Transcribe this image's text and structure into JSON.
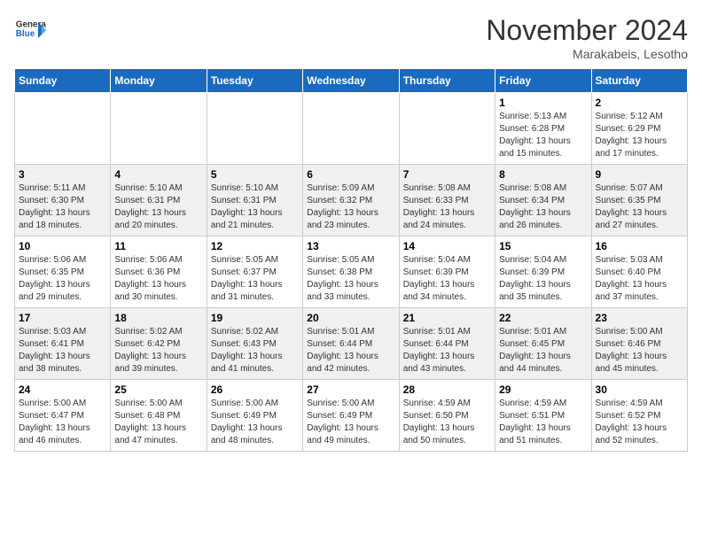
{
  "header": {
    "logo_general": "General",
    "logo_blue": "Blue",
    "month": "November 2024",
    "location": "Marakabeis, Lesotho"
  },
  "weekdays": [
    "Sunday",
    "Monday",
    "Tuesday",
    "Wednesday",
    "Thursday",
    "Friday",
    "Saturday"
  ],
  "weeks": [
    [
      {
        "day": "",
        "info": ""
      },
      {
        "day": "",
        "info": ""
      },
      {
        "day": "",
        "info": ""
      },
      {
        "day": "",
        "info": ""
      },
      {
        "day": "",
        "info": ""
      },
      {
        "day": "1",
        "info": "Sunrise: 5:13 AM\nSunset: 6:28 PM\nDaylight: 13 hours and 15 minutes."
      },
      {
        "day": "2",
        "info": "Sunrise: 5:12 AM\nSunset: 6:29 PM\nDaylight: 13 hours and 17 minutes."
      }
    ],
    [
      {
        "day": "3",
        "info": "Sunrise: 5:11 AM\nSunset: 6:30 PM\nDaylight: 13 hours and 18 minutes."
      },
      {
        "day": "4",
        "info": "Sunrise: 5:10 AM\nSunset: 6:31 PM\nDaylight: 13 hours and 20 minutes."
      },
      {
        "day": "5",
        "info": "Sunrise: 5:10 AM\nSunset: 6:31 PM\nDaylight: 13 hours and 21 minutes."
      },
      {
        "day": "6",
        "info": "Sunrise: 5:09 AM\nSunset: 6:32 PM\nDaylight: 13 hours and 23 minutes."
      },
      {
        "day": "7",
        "info": "Sunrise: 5:08 AM\nSunset: 6:33 PM\nDaylight: 13 hours and 24 minutes."
      },
      {
        "day": "8",
        "info": "Sunrise: 5:08 AM\nSunset: 6:34 PM\nDaylight: 13 hours and 26 minutes."
      },
      {
        "day": "9",
        "info": "Sunrise: 5:07 AM\nSunset: 6:35 PM\nDaylight: 13 hours and 27 minutes."
      }
    ],
    [
      {
        "day": "10",
        "info": "Sunrise: 5:06 AM\nSunset: 6:35 PM\nDaylight: 13 hours and 29 minutes."
      },
      {
        "day": "11",
        "info": "Sunrise: 5:06 AM\nSunset: 6:36 PM\nDaylight: 13 hours and 30 minutes."
      },
      {
        "day": "12",
        "info": "Sunrise: 5:05 AM\nSunset: 6:37 PM\nDaylight: 13 hours and 31 minutes."
      },
      {
        "day": "13",
        "info": "Sunrise: 5:05 AM\nSunset: 6:38 PM\nDaylight: 13 hours and 33 minutes."
      },
      {
        "day": "14",
        "info": "Sunrise: 5:04 AM\nSunset: 6:39 PM\nDaylight: 13 hours and 34 minutes."
      },
      {
        "day": "15",
        "info": "Sunrise: 5:04 AM\nSunset: 6:39 PM\nDaylight: 13 hours and 35 minutes."
      },
      {
        "day": "16",
        "info": "Sunrise: 5:03 AM\nSunset: 6:40 PM\nDaylight: 13 hours and 37 minutes."
      }
    ],
    [
      {
        "day": "17",
        "info": "Sunrise: 5:03 AM\nSunset: 6:41 PM\nDaylight: 13 hours and 38 minutes."
      },
      {
        "day": "18",
        "info": "Sunrise: 5:02 AM\nSunset: 6:42 PM\nDaylight: 13 hours and 39 minutes."
      },
      {
        "day": "19",
        "info": "Sunrise: 5:02 AM\nSunset: 6:43 PM\nDaylight: 13 hours and 41 minutes."
      },
      {
        "day": "20",
        "info": "Sunrise: 5:01 AM\nSunset: 6:44 PM\nDaylight: 13 hours and 42 minutes."
      },
      {
        "day": "21",
        "info": "Sunrise: 5:01 AM\nSunset: 6:44 PM\nDaylight: 13 hours and 43 minutes."
      },
      {
        "day": "22",
        "info": "Sunrise: 5:01 AM\nSunset: 6:45 PM\nDaylight: 13 hours and 44 minutes."
      },
      {
        "day": "23",
        "info": "Sunrise: 5:00 AM\nSunset: 6:46 PM\nDaylight: 13 hours and 45 minutes."
      }
    ],
    [
      {
        "day": "24",
        "info": "Sunrise: 5:00 AM\nSunset: 6:47 PM\nDaylight: 13 hours and 46 minutes."
      },
      {
        "day": "25",
        "info": "Sunrise: 5:00 AM\nSunset: 6:48 PM\nDaylight: 13 hours and 47 minutes."
      },
      {
        "day": "26",
        "info": "Sunrise: 5:00 AM\nSunset: 6:49 PM\nDaylight: 13 hours and 48 minutes."
      },
      {
        "day": "27",
        "info": "Sunrise: 5:00 AM\nSunset: 6:49 PM\nDaylight: 13 hours and 49 minutes."
      },
      {
        "day": "28",
        "info": "Sunrise: 4:59 AM\nSunset: 6:50 PM\nDaylight: 13 hours and 50 minutes."
      },
      {
        "day": "29",
        "info": "Sunrise: 4:59 AM\nSunset: 6:51 PM\nDaylight: 13 hours and 51 minutes."
      },
      {
        "day": "30",
        "info": "Sunrise: 4:59 AM\nSunset: 6:52 PM\nDaylight: 13 hours and 52 minutes."
      }
    ]
  ]
}
